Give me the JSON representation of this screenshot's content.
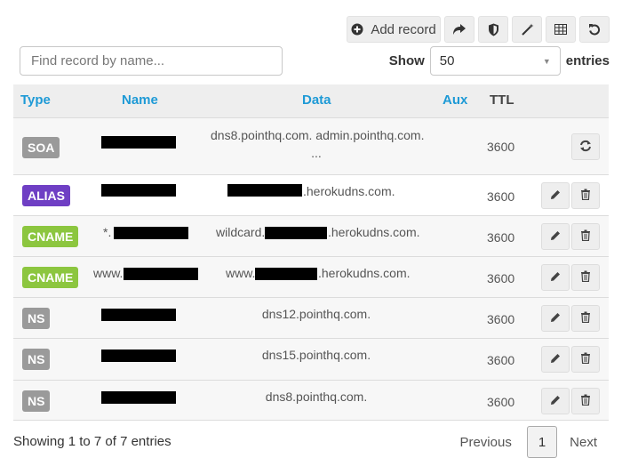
{
  "toolbar": {
    "add_record_label": "Add record",
    "icons": [
      "plus-circle-icon",
      "share-icon",
      "shield-icon",
      "magic-wand-icon",
      "table-icon",
      "undo-icon"
    ]
  },
  "search": {
    "placeholder": "Find record by name..."
  },
  "show": {
    "label": "Show",
    "value": "50",
    "suffix": "entries"
  },
  "table": {
    "headers": {
      "type": "Type",
      "name": "Name",
      "data": "Data",
      "aux": "Aux",
      "ttl": "TTL"
    },
    "rows": [
      {
        "type": "SOA",
        "type_color": "#9a9a9a",
        "name_prefix": "",
        "data_line1": "dns8.pointhq.com. admin.pointhq.com.",
        "data_line2": "...",
        "data_prefix": "",
        "data_suffix": "",
        "ttl": "3600",
        "actions": [
          "refresh-icon"
        ]
      },
      {
        "type": "ALIAS",
        "type_color": "#6f3fc4",
        "name_prefix": "",
        "data_prefix": "",
        "data_suffix": ".herokudns.com.",
        "ttl": "3600",
        "actions": [
          "pencil-icon",
          "trash-icon"
        ]
      },
      {
        "type": "CNAME",
        "type_color": "#8cc63f",
        "name_prefix": "*.",
        "data_prefix": "wildcard.",
        "data_suffix": ".herokudns.com.",
        "ttl": "3600",
        "actions": [
          "pencil-icon",
          "trash-icon"
        ]
      },
      {
        "type": "CNAME",
        "type_color": "#8cc63f",
        "name_prefix": "www.",
        "data_prefix": "www.",
        "data_suffix": ".herokudns.com.",
        "ttl": "3600",
        "actions": [
          "pencil-icon",
          "trash-icon"
        ]
      },
      {
        "type": "NS",
        "type_color": "#9a9a9a",
        "name_prefix": "",
        "data_text": "dns12.pointhq.com.",
        "ttl": "3600",
        "actions": [
          "pencil-icon",
          "trash-icon"
        ]
      },
      {
        "type": "NS",
        "type_color": "#9a9a9a",
        "name_prefix": "",
        "data_text": "dns15.pointhq.com.",
        "ttl": "3600",
        "actions": [
          "pencil-icon",
          "trash-icon"
        ]
      },
      {
        "type": "NS",
        "type_color": "#9a9a9a",
        "name_prefix": "",
        "data_text": "dns8.pointhq.com.",
        "ttl": "3600",
        "actions": [
          "pencil-icon",
          "trash-icon"
        ]
      }
    ]
  },
  "footer": {
    "info": "Showing 1 to 7 of 7 entries",
    "previous": "Previous",
    "current_page": "1",
    "next": "Next"
  },
  "colors": {
    "header_blue": "#1e9ad6",
    "alias_purple": "#6f3fc4",
    "cname_green": "#8cc63f",
    "badge_gray": "#9a9a9a"
  }
}
